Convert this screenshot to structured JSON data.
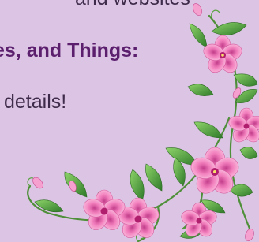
{
  "text": {
    "line1": "and websites",
    "line2": "es, and Things:",
    "line3": "details!"
  },
  "colors": {
    "background": "#dcc5e4",
    "heading_purple": "#5b1f6e",
    "body_text": "#3e2a4a",
    "flower_pink": "#f27fbd",
    "leaf_green": "#57a83e"
  },
  "decoration": {
    "icon": "pink-flower-vine-corner"
  }
}
